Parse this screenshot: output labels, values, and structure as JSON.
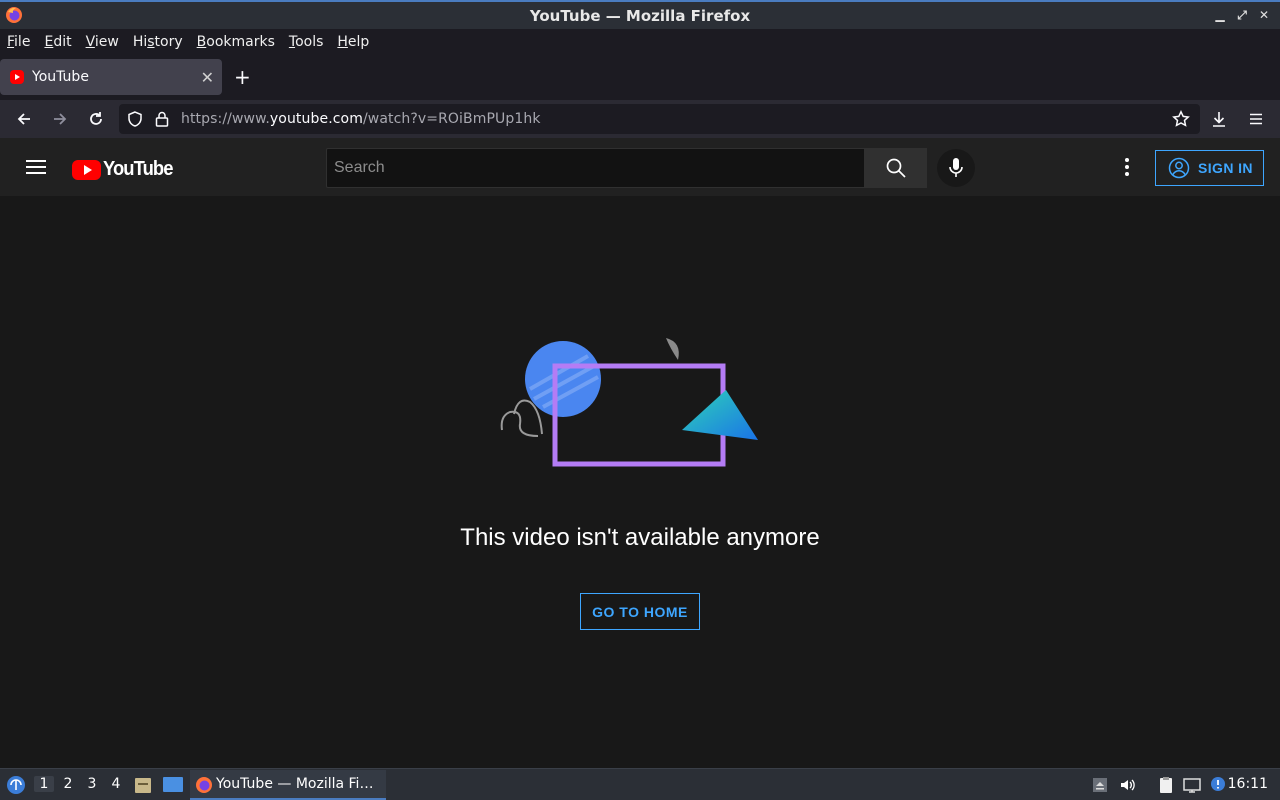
{
  "window": {
    "title": "YouTube — Mozilla Firefox"
  },
  "menubar": {
    "items": [
      {
        "label": "File",
        "key": "F",
        "rest": "ile"
      },
      {
        "label": "Edit",
        "key": "E",
        "rest": "dit"
      },
      {
        "label": "View",
        "key": "V",
        "rest": "iew"
      },
      {
        "label": "History",
        "key": "s",
        "pre": "Hi",
        "rest": "tory"
      },
      {
        "label": "Bookmarks",
        "key": "B",
        "rest": "ookmarks"
      },
      {
        "label": "Tools",
        "key": "T",
        "rest": "ools"
      },
      {
        "label": "Help",
        "key": "H",
        "rest": "elp"
      }
    ]
  },
  "tabs": [
    {
      "label": "YouTube",
      "favicon": "youtube-icon",
      "active": true
    }
  ],
  "navbar": {
    "url_prefix": "https://www.",
    "url_domain": "youtube.com",
    "url_path": "/watch?v=ROiBmPUp1hk"
  },
  "youtube": {
    "logo_text": "YouTube",
    "search_placeholder": "Search",
    "signin_label": "SIGN IN",
    "message": "This video isn't available anymore",
    "home_button": "GO TO HOME",
    "accent": "#3ea6ff",
    "brand_red": "#ff0000"
  },
  "taskbar": {
    "workspaces": [
      "1",
      "2",
      "3",
      "4"
    ],
    "active_workspace": "1",
    "task_label": "YouTube — Mozilla Fi…",
    "clock": "16:11"
  }
}
